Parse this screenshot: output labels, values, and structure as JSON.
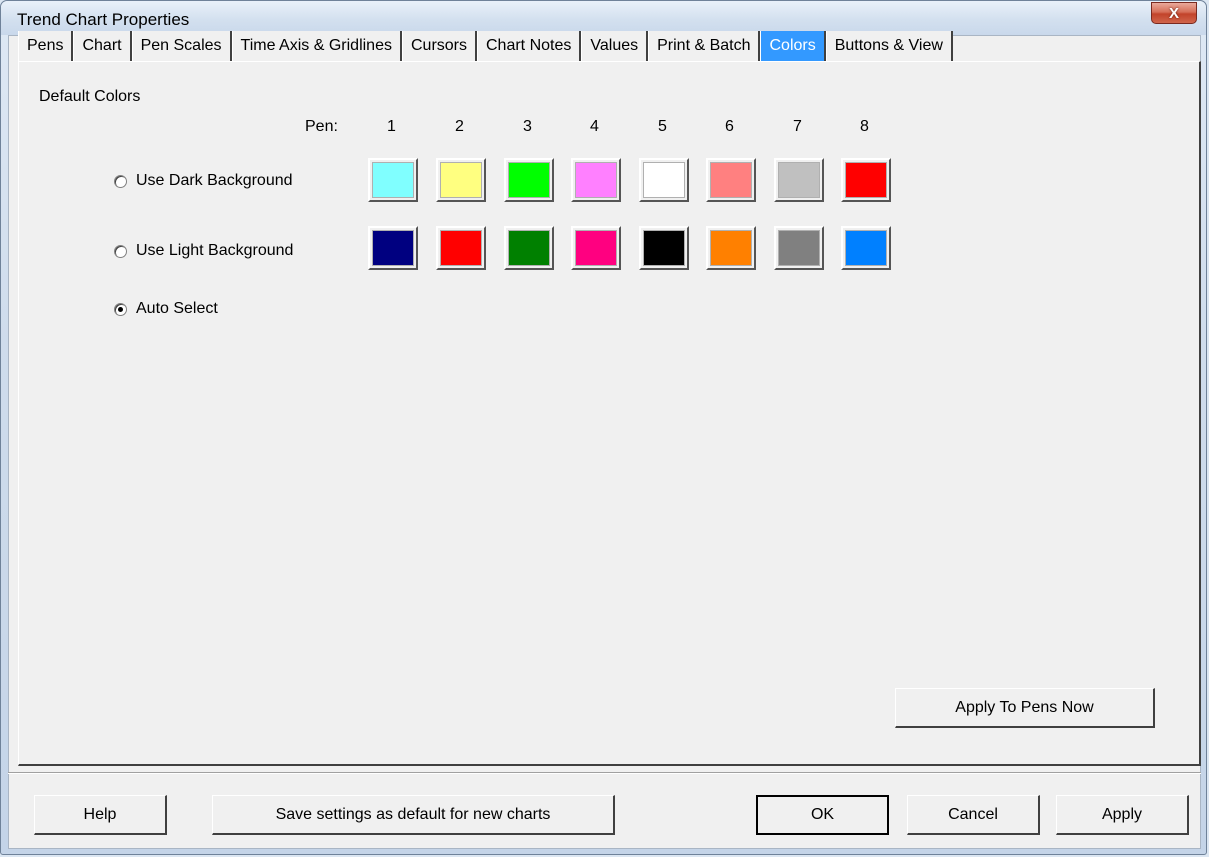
{
  "window": {
    "title": "Trend Chart Properties",
    "close_glyph": "X"
  },
  "tabs": [
    {
      "label": "Pens"
    },
    {
      "label": "Chart"
    },
    {
      "label": "Pen Scales"
    },
    {
      "label": "Time Axis & Gridlines"
    },
    {
      "label": "Cursors"
    },
    {
      "label": "Chart Notes"
    },
    {
      "label": "Values"
    },
    {
      "label": "Print & Batch"
    },
    {
      "label": "Colors",
      "active": true
    },
    {
      "label": "Buttons & View"
    }
  ],
  "colors": {
    "group_label": "Default Colors",
    "pen_label": "Pen:",
    "pen_numbers": [
      "1",
      "2",
      "3",
      "4",
      "5",
      "6",
      "7",
      "8"
    ],
    "dark": {
      "label": "Use Dark Background",
      "selected": false,
      "swatches": [
        "#80ffff",
        "#ffff80",
        "#00ff00",
        "#ff80ff",
        "#ffffff",
        "#ff8080",
        "#c0c0c0",
        "#ff0000"
      ]
    },
    "light": {
      "label": "Use Light Background",
      "selected": false,
      "swatches": [
        "#000080",
        "#ff0000",
        "#008000",
        "#ff0080",
        "#000000",
        "#ff8000",
        "#808080",
        "#0080ff"
      ]
    },
    "auto": {
      "label": "Auto Select",
      "selected": true
    },
    "apply_pens_label": "Apply To Pens Now"
  },
  "footer": {
    "help": "Help",
    "save_default": "Save settings as default for new charts",
    "ok": "OK",
    "cancel": "Cancel",
    "apply": "Apply"
  }
}
